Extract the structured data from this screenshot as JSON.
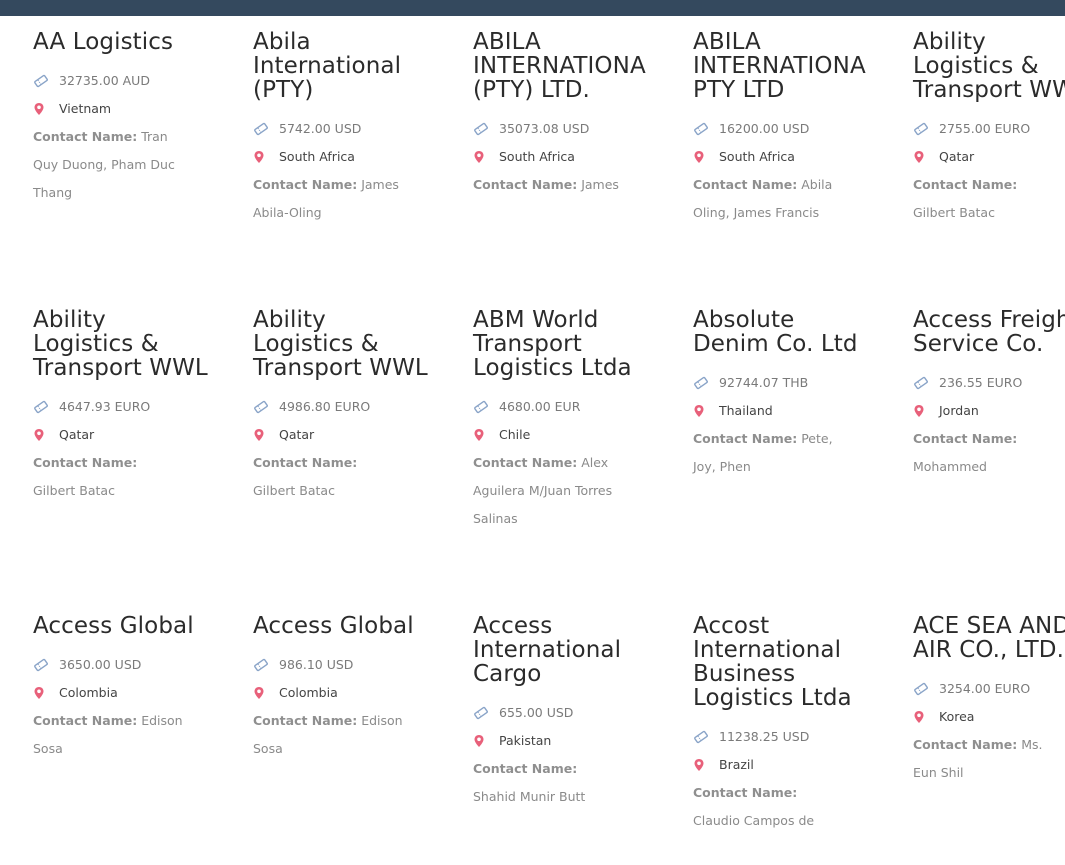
{
  "contact_label": "Contact Name:",
  "icons": {
    "amount": "ticket-icon",
    "location": "map-pin-icon"
  },
  "colors": {
    "topbar": "#34495e",
    "pin": "#e8607a",
    "ticket": "#8aa4c8"
  },
  "rows": [
    [
      {
        "name": "AA Logistics",
        "amount": "32735.00 AUD",
        "country": "Vietnam",
        "contact": "Tran Quy Duong, Pham Duc Thang"
      },
      {
        "name": "Abila International (PTY)",
        "amount": "5742.00 USD",
        "country": "South Africa",
        "contact": "James Abila-Oling"
      },
      {
        "name": "ABILA INTERNATIONA (PTY) LTD.",
        "amount": "35073.08 USD",
        "country": "South Africa",
        "contact": "James"
      },
      {
        "name": "ABILA INTERNATIONA PTY LTD",
        "amount": "16200.00 USD",
        "country": "South Africa",
        "contact": "Abila Oling, James Francis"
      },
      {
        "name": "Ability Logistics & Transport WWL",
        "amount": "2755.00 EURO",
        "country": "Qatar",
        "contact": "Gilbert Batac"
      }
    ],
    [
      {
        "name": "Ability Logistics & Transport WWL",
        "amount": "4647.93 EURO",
        "country": "Qatar",
        "contact": "Gilbert Batac"
      },
      {
        "name": "Ability Logistics & Transport WWL",
        "amount": "4986.80 EURO",
        "country": "Qatar",
        "contact": "Gilbert Batac"
      },
      {
        "name": "ABM World Transport Logistics Ltda",
        "amount": "4680.00 EUR",
        "country": "Chile",
        "contact": "Alex Aguilera M/Juan Torres Salinas"
      },
      {
        "name": "Absolute Denim Co. Ltd",
        "amount": "92744.07 THB",
        "country": "Thailand",
        "contact": "Pete, Joy, Phen"
      },
      {
        "name": "Access Freight Service Co.",
        "amount": "236.55 EURO",
        "country": "Jordan",
        "contact": "Mohammed"
      }
    ],
    [
      {
        "name": "Access Global",
        "amount": "3650.00 USD",
        "country": "Colombia",
        "contact": "Edison Sosa"
      },
      {
        "name": "Access Global",
        "amount": "986.10 USD",
        "country": "Colombia",
        "contact": "Edison Sosa"
      },
      {
        "name": "Access International Cargo",
        "amount": "655.00 USD",
        "country": "Pakistan",
        "contact": "Shahid Munir Butt"
      },
      {
        "name": "Accost International Business Logistics Ltda",
        "amount": "11238.25 USD",
        "country": "Brazil",
        "contact": "Claudio Campos de"
      },
      {
        "name": "ACE SEA AND AIR CO., LTD.",
        "amount": "3254.00 EURO",
        "country": "Korea",
        "contact": "Ms. Eun Shil"
      }
    ]
  ]
}
